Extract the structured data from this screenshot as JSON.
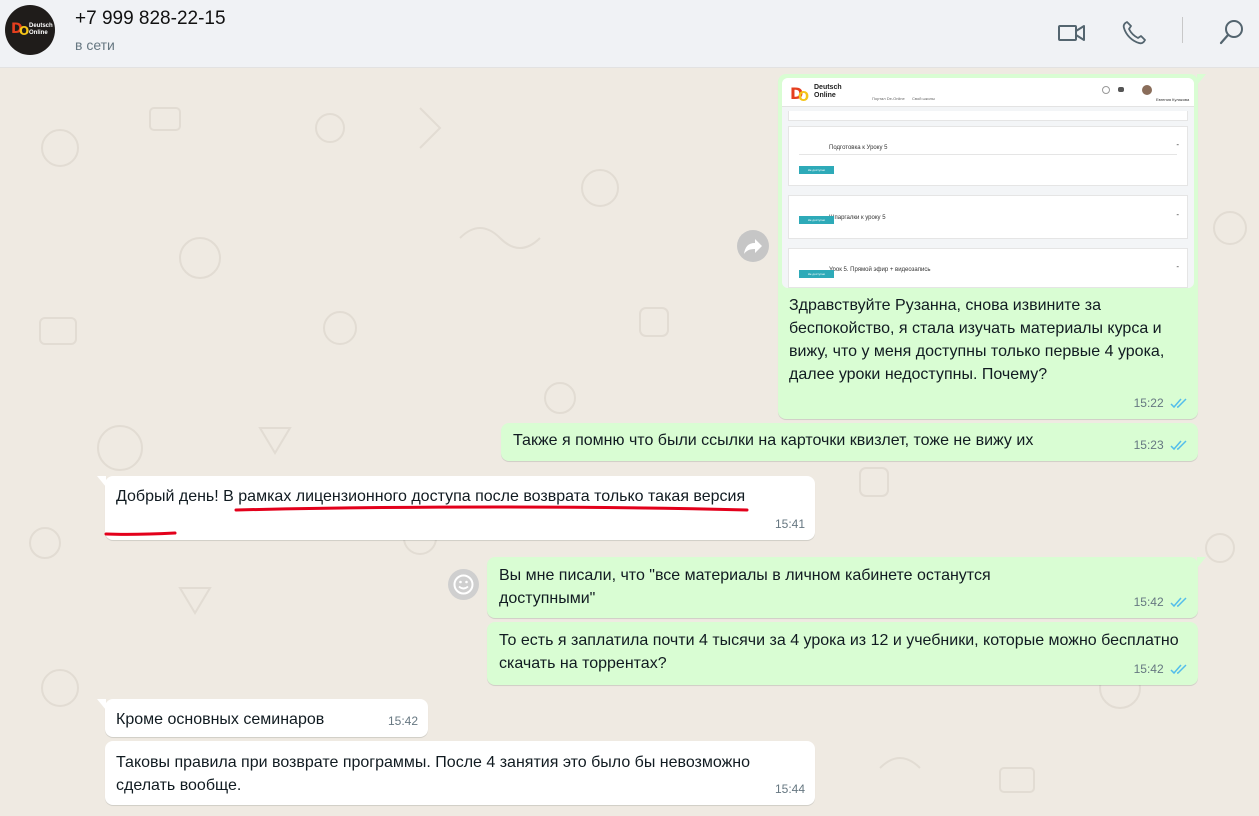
{
  "header": {
    "contact_name": "+7 999 828-22-15",
    "status": "в сети",
    "avatar_logo_text": "Deutsch Online",
    "icons": [
      "video-call-icon",
      "phone-icon",
      "search-icon"
    ]
  },
  "image_preview": {
    "logo_line1": "Deutsch",
    "logo_line2": "Online",
    "nav_items": [
      "Портал De-Online",
      "Свой школы"
    ],
    "user_name": "Евгения Кулакова",
    "cards": [
      {
        "title": "Подготовка к Уроку 5",
        "button": "Не доступно"
      },
      {
        "title": "Шпаргалки к уроку 5",
        "button": "Не доступно"
      },
      {
        "title": "Урок 5. Прямой эфир + видеозапись",
        "button": "Не доступно"
      }
    ]
  },
  "messages": [
    {
      "direction": "out",
      "text": "Здравствуйте Рузанна, снова извините за беспокойство, я стала изучать материалы курса и вижу, что у меня доступны только первые 4 урока, далее уроки недоступны. Почему?",
      "time": "15:22",
      "status": "read"
    },
    {
      "direction": "out",
      "text": "Также я помню что были ссылки на карточки квизлет, тоже не вижу их",
      "time": "15:23",
      "status": "read"
    },
    {
      "direction": "in",
      "text": "Добрый день! В рамках лицензионного доступа после возврата только такая версия",
      "time": "15:41"
    },
    {
      "direction": "out",
      "text": "Вы мне писали, что \"все материалы в личном кабинете останутся доступными\"",
      "time": "15:42",
      "status": "read"
    },
    {
      "direction": "out",
      "text": "То есть я заплатила почти 4 тысячи за 4 урока из 12 и учебники, которые можно бесплатно скачать на торрентах?",
      "time": "15:42",
      "status": "read"
    },
    {
      "direction": "in",
      "text": "Кроме основных семинаров",
      "time": "15:42"
    },
    {
      "direction": "in",
      "text": "Таковы правила при возврате программы. После 4 занятия это было бы невозможно сделать вообще.",
      "time": "15:44"
    }
  ],
  "colors": {
    "outgoing_bubble": "#d9fdd3",
    "incoming_bubble": "#ffffff",
    "read_ticks": "#53bdeb",
    "chat_background": "#efeae2",
    "annotation_underline": "#e3001b"
  }
}
